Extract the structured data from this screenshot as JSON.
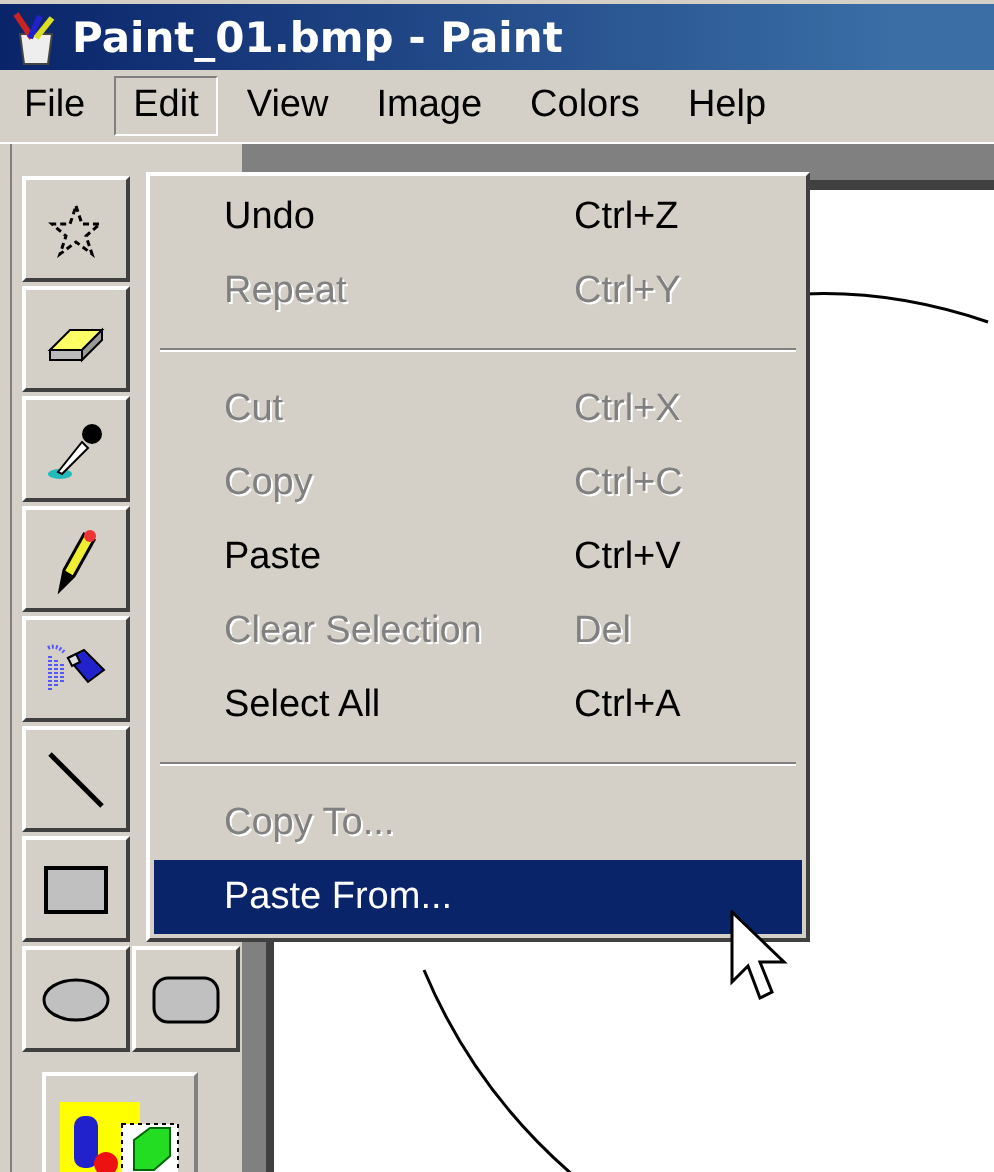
{
  "window": {
    "title": "Paint_01.bmp - Paint"
  },
  "menu_bar": [
    {
      "label": "File",
      "selected": false
    },
    {
      "label": "Edit",
      "selected": true
    },
    {
      "label": "View",
      "selected": false
    },
    {
      "label": "Image",
      "selected": false
    },
    {
      "label": "Colors",
      "selected": false
    },
    {
      "label": "Help",
      "selected": false
    }
  ],
  "edit_menu": [
    {
      "kind": "item",
      "label": "Undo",
      "shortcut": "Ctrl+Z",
      "disabled": false,
      "selected": false
    },
    {
      "kind": "item",
      "label": "Repeat",
      "shortcut": "Ctrl+Y",
      "disabled": true,
      "selected": false
    },
    {
      "kind": "separator"
    },
    {
      "kind": "item",
      "label": "Cut",
      "shortcut": "Ctrl+X",
      "disabled": true,
      "selected": false
    },
    {
      "kind": "item",
      "label": "Copy",
      "shortcut": "Ctrl+C",
      "disabled": true,
      "selected": false
    },
    {
      "kind": "item",
      "label": "Paste",
      "shortcut": "Ctrl+V",
      "disabled": false,
      "selected": false
    },
    {
      "kind": "item",
      "label": "Clear Selection",
      "shortcut": "Del",
      "disabled": true,
      "selected": false
    },
    {
      "kind": "item",
      "label": "Select All",
      "shortcut": "Ctrl+A",
      "disabled": false,
      "selected": false
    },
    {
      "kind": "separator"
    },
    {
      "kind": "item",
      "label": "Copy To...",
      "disabled": true,
      "selected": false
    },
    {
      "kind": "item",
      "label": "Paste From...",
      "disabled": false,
      "selected": true
    }
  ],
  "toolbox": [
    {
      "kind": "free-select"
    },
    {
      "kind": "eraser"
    },
    {
      "kind": "eyedropper"
    },
    {
      "kind": "pencil"
    },
    {
      "kind": "airbrush"
    },
    {
      "kind": "line"
    },
    {
      "kind": "rectangle"
    },
    {
      "kind": "ellipse"
    },
    {
      "kind": "rounded-rectangle"
    }
  ]
}
